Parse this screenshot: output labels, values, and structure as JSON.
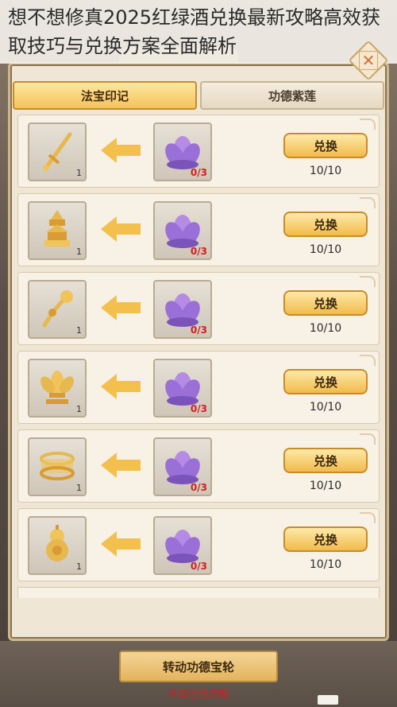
{
  "article_title": "想不想修真2025红绿酒兑换最新攻略高效获取技巧与兑换方案全面解析",
  "tabs": [
    {
      "label": "法宝印记",
      "active": true
    },
    {
      "label": "功德紫莲",
      "active": false
    }
  ],
  "rows": [
    {
      "item_icon": "sword-icon",
      "item_count": "1",
      "lotus_need": "0/3",
      "button": "兑换",
      "limit": "10/10"
    },
    {
      "item_icon": "pagoda-icon",
      "item_count": "1",
      "lotus_need": "0/3",
      "button": "兑换",
      "limit": "10/10"
    },
    {
      "item_icon": "ruyi-scepter-icon",
      "item_count": "1",
      "lotus_need": "0/3",
      "button": "兑换",
      "limit": "10/10"
    },
    {
      "item_icon": "lotus-throne-icon",
      "item_count": "1",
      "lotus_need": "0/3",
      "button": "兑换",
      "limit": "10/10"
    },
    {
      "item_icon": "golden-ring-icon",
      "item_count": "1",
      "lotus_need": "0/3",
      "button": "兑换",
      "limit": "10/10"
    },
    {
      "item_icon": "gourd-icon",
      "item_count": "1",
      "lotus_need": "0/3",
      "button": "兑换",
      "limit": "10/10"
    }
  ],
  "footer": {
    "spin_button": "转动功德宝轮",
    "no_times_text": "今日已无次数"
  },
  "colors": {
    "accent_gold": "#f2bb4c",
    "lotus_purple": "#9b6fd8",
    "warning_red": "#d42020"
  }
}
